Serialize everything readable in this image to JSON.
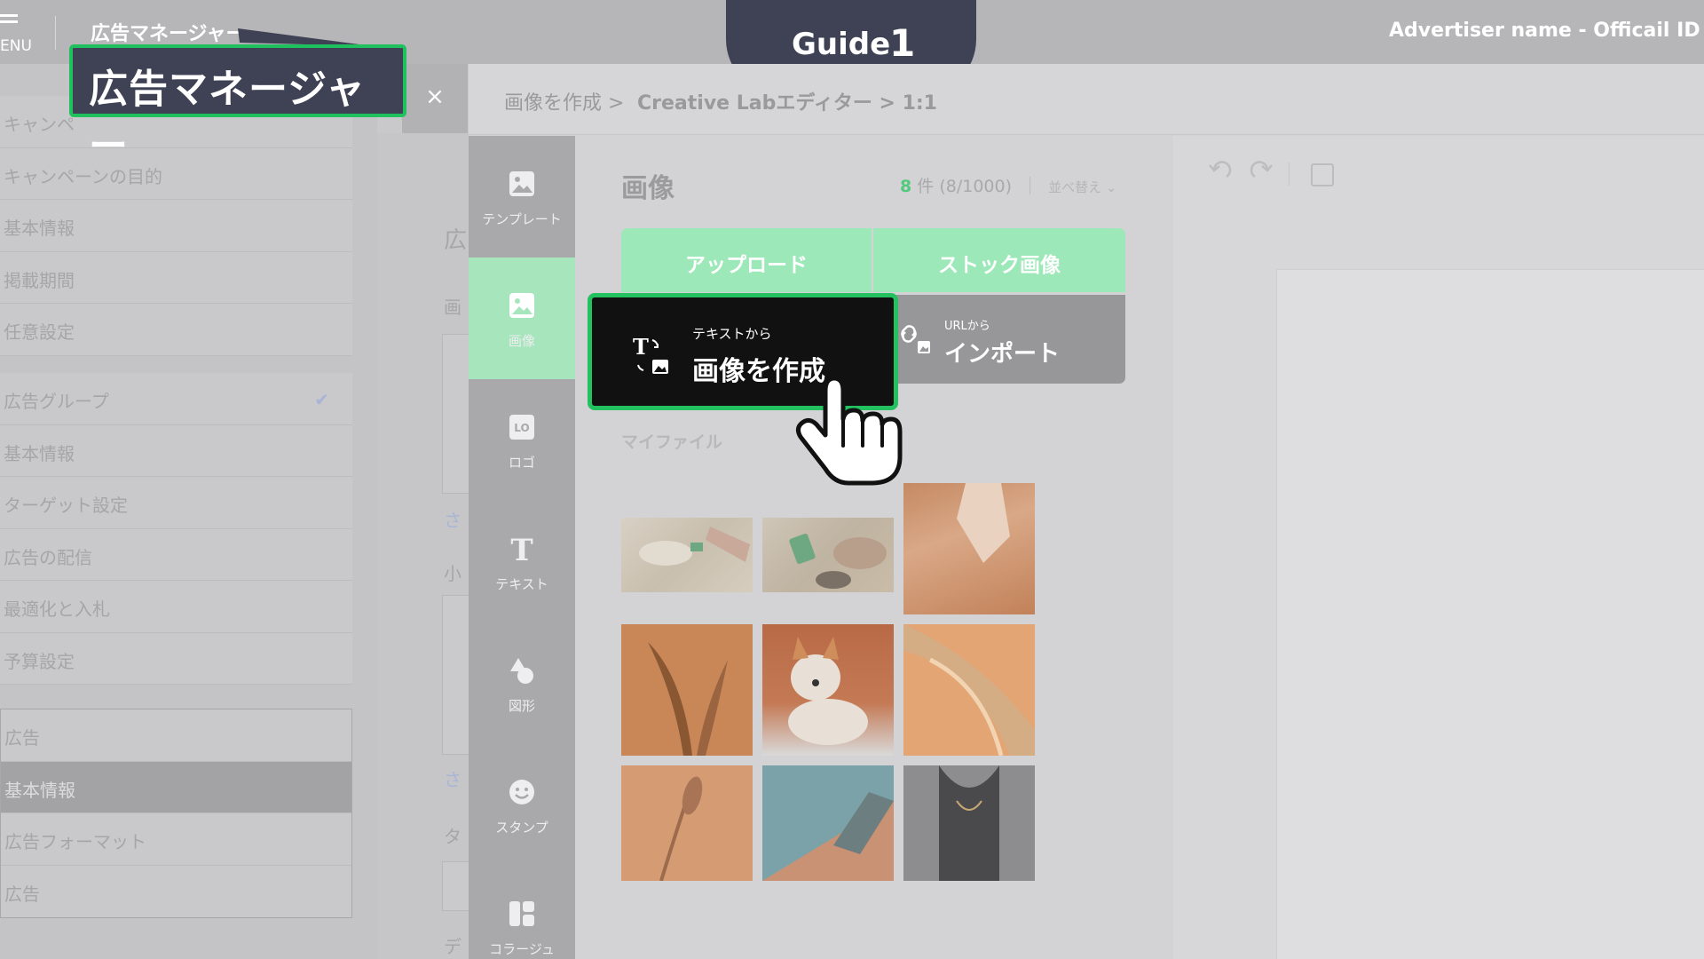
{
  "header": {
    "menu_label": "ENU",
    "app_title": "広告マネージャー",
    "advertiser": "Advertiser name - Officail ID for u"
  },
  "guide": {
    "label": "Guide",
    "step": "1"
  },
  "callout": {
    "text": "広告マネージャー"
  },
  "leftnav": {
    "campaign": [
      "キャンペ",
      "キャンペーンの目的",
      "基本情報",
      "掲載期間",
      "任意設定"
    ],
    "adgroup": {
      "items": [
        "広告グループ",
        "基本情報",
        "ターゲット設定",
        "広告の配信",
        "最適化と入札",
        "予算設定"
      ],
      "check": "✔"
    },
    "ad": {
      "items": [
        "広告",
        "基本情報",
        "広告フォーマット",
        "広告"
      ],
      "active_index": 1
    }
  },
  "background_form": {
    "fragments": [
      "広",
      "画",
      "さ",
      "小",
      "さ",
      "タ",
      "デ"
    ]
  },
  "close_label": "×",
  "breadcrumb": {
    "part1": "画像を作成 >",
    "part2": "Creative Labエディター > 1:1"
  },
  "toolrail": {
    "items": [
      {
        "label": "テンプレート",
        "icon": "template-icon"
      },
      {
        "label": "画像",
        "icon": "image-icon"
      },
      {
        "label": "ロゴ",
        "icon": "logo-icon"
      },
      {
        "label": "テキスト",
        "icon": "text-icon"
      },
      {
        "label": "図形",
        "icon": "shape-icon"
      },
      {
        "label": "スタンプ",
        "icon": "stamp-icon"
      },
      {
        "label": "コラージュ",
        "icon": "collage-icon"
      }
    ],
    "active": "画像"
  },
  "panel": {
    "title": "画像",
    "count_num": "8",
    "count_unit": "件",
    "count_detail": "(8/1000)",
    "sort_label": "並べ替え",
    "upload_label": "アップロード",
    "stock_label": "ストック画像",
    "text2img_small": "テキストから",
    "text2img_big": "画像を作成",
    "import_small": "URLから",
    "import_big": "インポート",
    "myfile_label": "マイファイル"
  },
  "colors": {
    "accent_green": "#1fc15e",
    "guide_bg": "#3e4254",
    "green_button": "#9de8b8"
  }
}
